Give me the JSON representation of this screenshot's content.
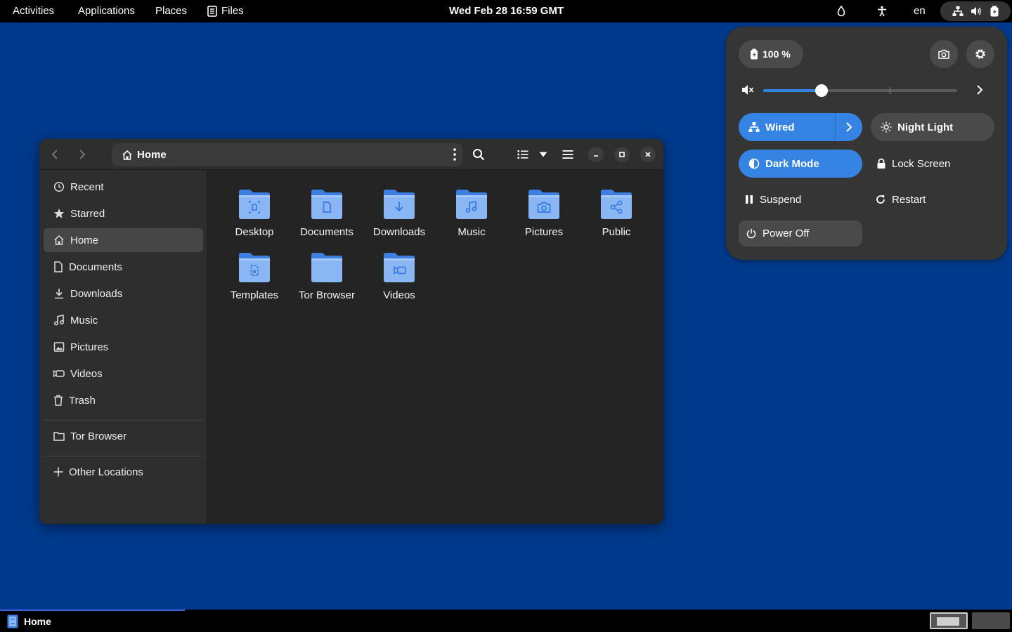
{
  "topbar": {
    "activities": "Activities",
    "applications": "Applications",
    "places": "Places",
    "files": "Files",
    "clock": "Wed Feb 28  16:59 GMT",
    "lang": "en"
  },
  "quick_settings": {
    "battery": "100 %",
    "volume_percent": 30,
    "wired": "Wired",
    "night_light": "Night Light",
    "dark_mode": "Dark Mode",
    "lock_screen": "Lock Screen",
    "suspend": "Suspend",
    "restart": "Restart",
    "power_off": "Power Off"
  },
  "window": {
    "path": "Home",
    "sidebar": [
      {
        "label": "Recent",
        "icon": "clock-icon"
      },
      {
        "label": "Starred",
        "icon": "star-icon"
      },
      {
        "label": "Home",
        "icon": "home-icon"
      },
      {
        "label": "Documents",
        "icon": "document-icon"
      },
      {
        "label": "Downloads",
        "icon": "download-icon"
      },
      {
        "label": "Music",
        "icon": "music-icon"
      },
      {
        "label": "Pictures",
        "icon": "picture-icon"
      },
      {
        "label": "Videos",
        "icon": "video-icon"
      },
      {
        "label": "Trash",
        "icon": "trash-icon"
      },
      {
        "label": "Tor Browser",
        "icon": "folder-icon"
      },
      {
        "label": "Other Locations",
        "icon": "plus-icon"
      }
    ],
    "files": [
      {
        "label": "Desktop",
        "emblem": "desktop"
      },
      {
        "label": "Documents",
        "emblem": "document"
      },
      {
        "label": "Downloads",
        "emblem": "download"
      },
      {
        "label": "Music",
        "emblem": "music"
      },
      {
        "label": "Pictures",
        "emblem": "camera"
      },
      {
        "label": "Public",
        "emblem": "share"
      },
      {
        "label": "Templates",
        "emblem": "template"
      },
      {
        "label": "Tor Browser",
        "emblem": "none"
      },
      {
        "label": "Videos",
        "emblem": "video"
      }
    ]
  },
  "taskbar": {
    "active_window": "Home"
  },
  "colors": {
    "desktop": "#003a8c",
    "accent": "#3584e4",
    "folder": "#5e9bf0"
  }
}
